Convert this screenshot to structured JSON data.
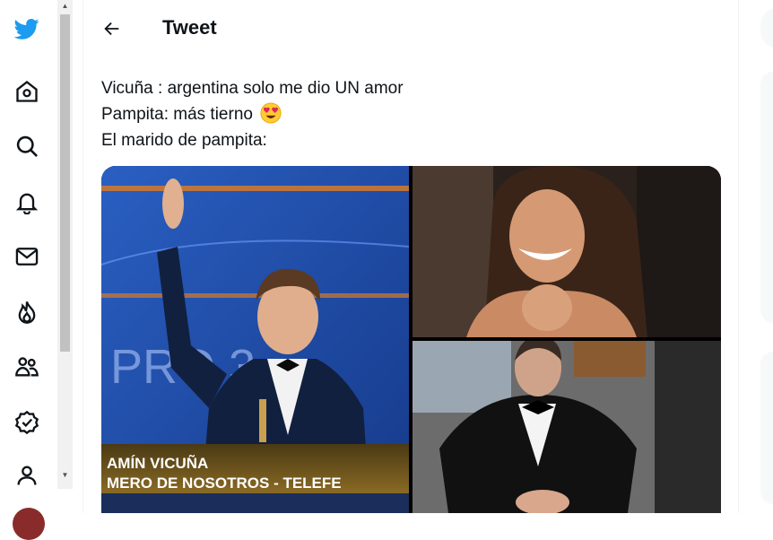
{
  "header": {
    "title": "Tweet"
  },
  "tweet": {
    "line1": "Vicuña : argentina solo me dio UN amor",
    "line2": "Pampita: más tierno",
    "line3": "El marido de pampita:",
    "emoji": "heart-eyes-emoji"
  },
  "media": {
    "photo1_caption_line1": "AMÍN VICUÑA",
    "photo1_caption_line2": "MERO DE NOSOTROS - TELEFE",
    "photo1_background_text": "PRO  3"
  },
  "sidebar": {
    "items": [
      {
        "icon": "twitter-logo-icon"
      },
      {
        "icon": "home-icon"
      },
      {
        "icon": "search-icon"
      },
      {
        "icon": "bell-icon"
      },
      {
        "icon": "mail-icon"
      },
      {
        "icon": "flame-icon"
      },
      {
        "icon": "communities-icon"
      },
      {
        "icon": "verified-icon"
      },
      {
        "icon": "profile-icon"
      }
    ]
  },
  "colors": {
    "brand": "#1d9bf0",
    "text": "#0f1419"
  }
}
